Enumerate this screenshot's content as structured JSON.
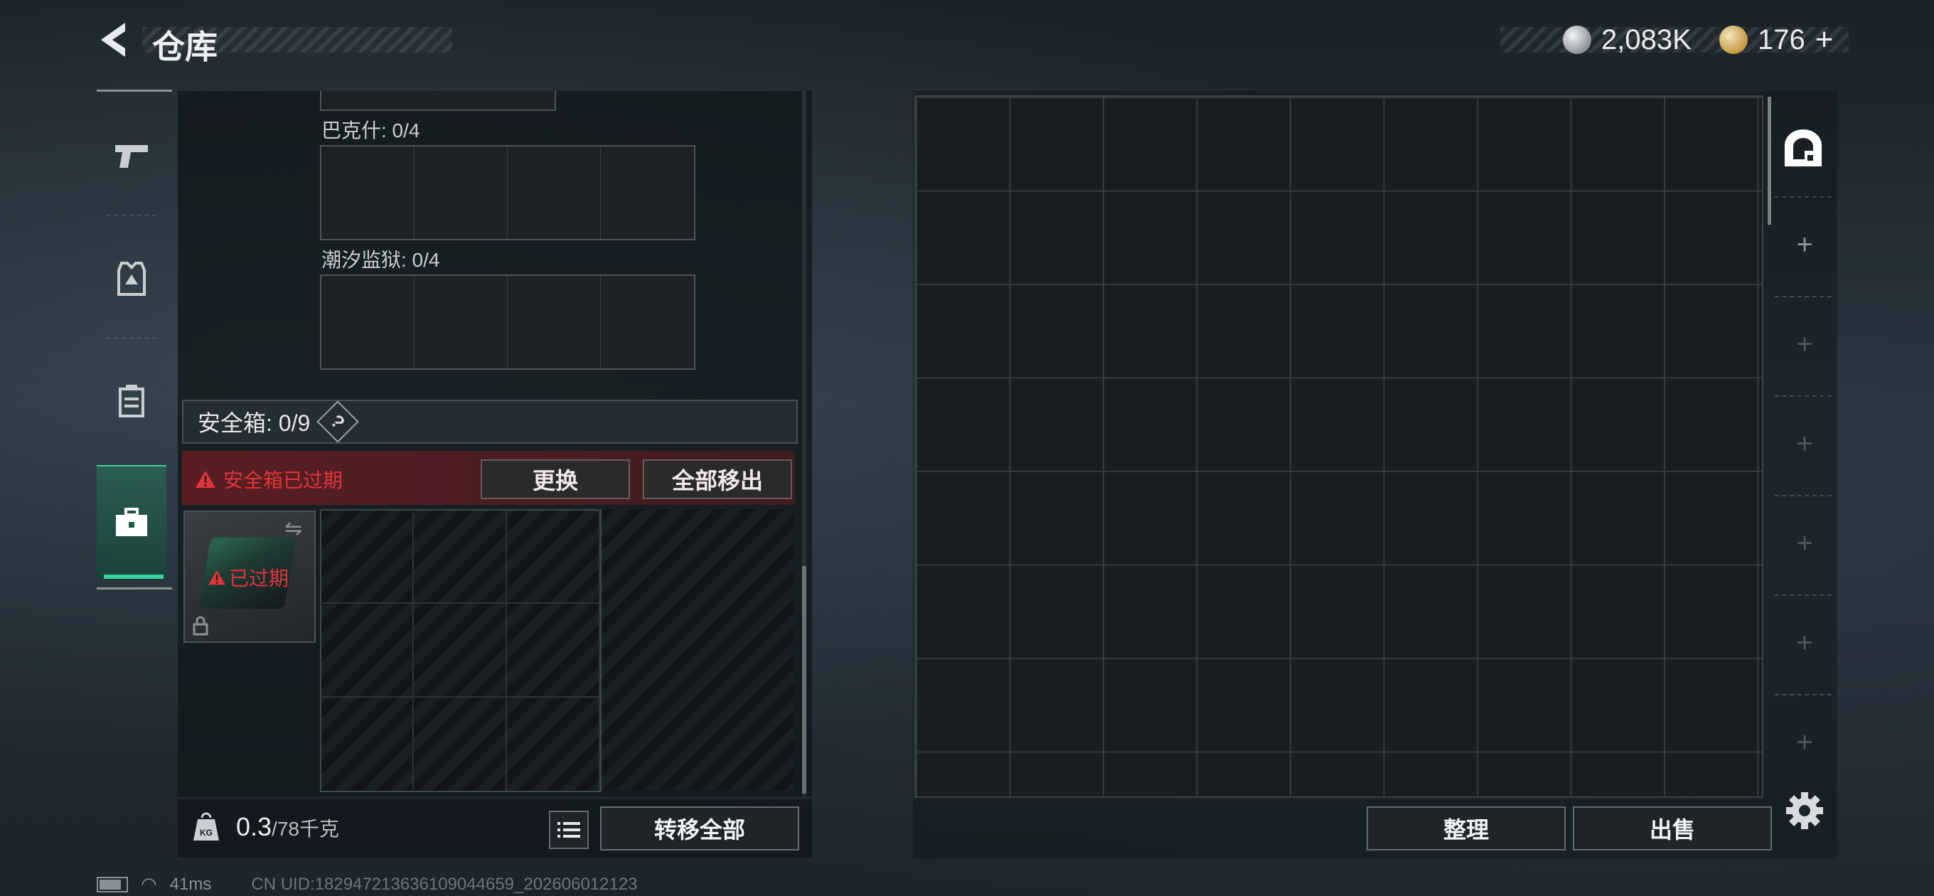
{
  "header": {
    "title": "仓库",
    "currency_silver": "2,083K",
    "currency_gold": "176",
    "add_symbol": "+"
  },
  "left_panel": {
    "map_slots": [
      {
        "label": "巴克什: 0/4"
      },
      {
        "label": "潮汐监狱: 0/4"
      }
    ],
    "safe_box": {
      "label": "安全箱: 0/9",
      "help": "?",
      "expired_warning": "安全箱已过期",
      "replace_button": "更换",
      "remove_all_button": "全部移出",
      "item_status": "已过期"
    },
    "footer": {
      "weight_current": "0.3",
      "weight_capacity": "/78千克",
      "transfer_all_button": "转移全部"
    }
  },
  "right_panel": {
    "organize_button": "整理",
    "sell_button": "出售"
  },
  "status_bar": {
    "ping": "41ms",
    "uid": "CN UID:18294721363610904​4659_202606012123"
  },
  "colors": {
    "accent_green": "#3ad29a",
    "warning_red": "#e0353a",
    "expired_bg": "#5a1e22"
  },
  "icons": [
    "back-arrow-icon",
    "silver-coin-icon",
    "gold-coin-icon",
    "pistol-icon",
    "armor-vest-icon",
    "backpack-icon",
    "briefcase-icon",
    "kg-weight-icon",
    "list-icon",
    "warehouse-icon",
    "gear-icon",
    "swap-icon",
    "lock-icon",
    "warning-icon"
  ]
}
